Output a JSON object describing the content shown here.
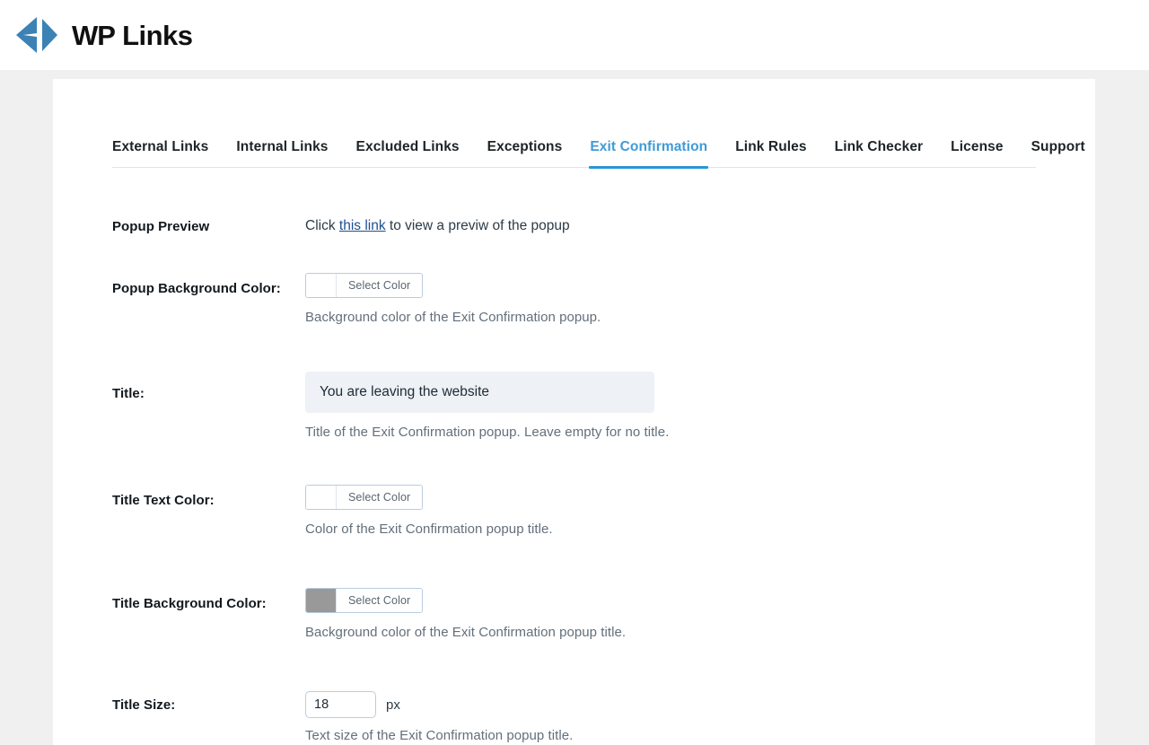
{
  "header": {
    "brand_name_wp": "WP",
    "brand_name_links": "Links",
    "logo_icon": "code-chevron-logo-icon",
    "logo_color": "#3c82b4"
  },
  "tabs": [
    {
      "label": "External Links",
      "active": false
    },
    {
      "label": "Internal Links",
      "active": false
    },
    {
      "label": "Excluded Links",
      "active": false
    },
    {
      "label": "Exceptions",
      "active": false
    },
    {
      "label": "Exit Confirmation",
      "active": true
    },
    {
      "label": "Link Rules",
      "active": false
    },
    {
      "label": "Link Checker",
      "active": false
    },
    {
      "label": "License",
      "active": false
    },
    {
      "label": "Support",
      "active": false
    }
  ],
  "active_tab_color": "#2a96d6",
  "form": {
    "popup_preview": {
      "label": "Popup Preview",
      "text_before": "Click ",
      "link_text": "this link",
      "text_after": " to view a previw of the popup",
      "link_color": "#1d4f91"
    },
    "popup_background_color": {
      "label": "Popup Background Color:",
      "button_label": "Select Color",
      "swatch_color": "#ffffff",
      "help": "Background color of the Exit Confirmation popup."
    },
    "title": {
      "label": "Title:",
      "value": "You are leaving the website",
      "placeholder": "",
      "help": "Title of the Exit Confirmation popup. Leave empty for no title."
    },
    "title_text_color": {
      "label": "Title Text Color:",
      "button_label": "Select Color",
      "swatch_color": "#ffffff",
      "help": "Color of the Exit Confirmation popup title."
    },
    "title_background_color": {
      "label": "Title Background Color:",
      "button_label": "Select Color",
      "swatch_color": "#999999",
      "help": "Background color of the Exit Confirmation popup title."
    },
    "title_size": {
      "label": "Title Size:",
      "value": "18",
      "unit": "px",
      "help": "Text size of the Exit Confirmation popup title."
    }
  }
}
